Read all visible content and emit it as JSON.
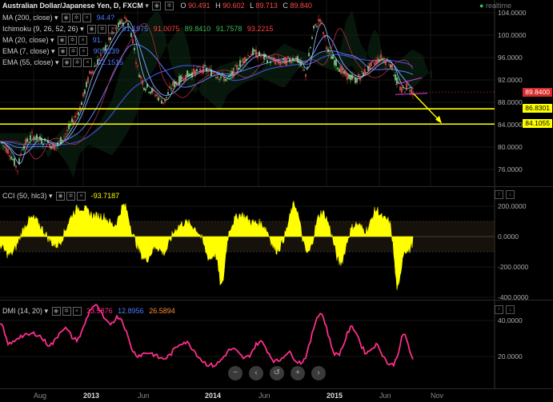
{
  "title": {
    "symbol": "Australian Dollar/Japanese Yen, D, FXCM",
    "o_label": "O",
    "o": "90.491",
    "h_label": "H",
    "h": "90.602",
    "l_label": "L",
    "l": "89.713",
    "c_label": "C",
    "c": "89.840"
  },
  "realtime": "realtime",
  "indicators": [
    {
      "label": "MA (200, close)",
      "values": [
        "94.4?"
      ]
    },
    {
      "label": "Ichimoku (9, 26, 52, 26)",
      "values": [
        "91.1975",
        "91.0075",
        "89.8410",
        "91.7578",
        "93.2215"
      ]
    },
    {
      "label": "MA (20, close)",
      "values": [
        "91."
      ]
    },
    {
      "label": "EMA (7, close)",
      "values": [
        "90.8239"
      ]
    },
    {
      "label": "EMA (55, close)",
      "values": [
        "92.1515"
      ]
    }
  ],
  "price_axis": [
    "104.0000",
    "100.0000",
    "96.0000",
    "92.0000",
    "88.0000",
    "84.0000",
    "80.0000",
    "76.0000"
  ],
  "price_tags": {
    "last": "89.8400",
    "line1": "86.8301",
    "line2": "84.1055"
  },
  "cci": {
    "label": "CCI (50, hlc3)",
    "value": "-93.7187",
    "axis": [
      "200.0000",
      "0.0000",
      "-200.0000",
      "-400.0000"
    ]
  },
  "dmi": {
    "label": "DMI (14, 20)",
    "values": [
      "33.5876",
      "12.8956",
      "26.5894"
    ],
    "axis": [
      "40.0000",
      "20.0000"
    ]
  },
  "time_axis": [
    "Aug",
    "2013",
    "Jun",
    "2014",
    "Jun",
    "2015",
    "Jun",
    "Nov"
  ],
  "colors": {
    "up": "#2ecc40",
    "down": "#e03030",
    "ichi_green": "#3fb950",
    "ichi_red": "#ff4040",
    "ichi_blue": "#4f7cff",
    "yellow": "#ffff00",
    "magenta": "#ff2d8a",
    "blue": "#4060ff",
    "grid": "#161616"
  },
  "icons": {
    "dropdown": "chevron-down-icon",
    "visibility": "eye-icon",
    "settings": "gear-icon",
    "close": "close-icon",
    "nav": [
      "zoom-out-icon",
      "pan-left-icon",
      "reset-icon",
      "zoom-in-icon",
      "pan-right-icon"
    ]
  }
}
